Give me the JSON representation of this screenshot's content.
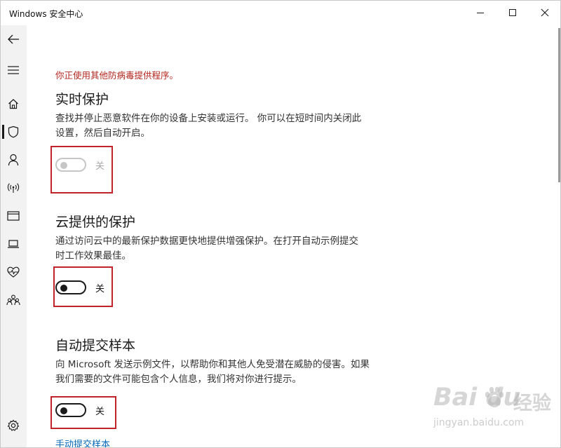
{
  "window": {
    "title": "Windows 安全中心",
    "controls": {
      "minimize_icon": "minimize-icon",
      "maximize_icon": "maximize-icon",
      "close_icon": "close-icon"
    }
  },
  "nav": {
    "items": [
      {
        "icon": "back-arrow-icon"
      },
      {
        "icon": "hamburger-menu-icon"
      },
      {
        "icon": "home-icon"
      },
      {
        "icon": "shield-icon",
        "active": true
      },
      {
        "icon": "account-icon"
      },
      {
        "icon": "network-antenna-icon"
      },
      {
        "icon": "app-browser-window-icon"
      },
      {
        "icon": "laptop-icon"
      },
      {
        "icon": "health-heart-icon"
      },
      {
        "icon": "family-icon"
      },
      {
        "icon": "gear-icon"
      }
    ]
  },
  "content": {
    "warning": "你正使用其他防病毒提供程序。",
    "sections": [
      {
        "title": "实时保护",
        "description_lines": [
          "查找并停止恶意软件在你的设备上安装或运行。 你可以在短时间内关闭此",
          "设置，然后自动开启。"
        ],
        "toggle_state": "关",
        "toggle_disabled": true
      },
      {
        "title": "云提供的保护",
        "description_lines": [
          "通过访问云中的最新保护数据更快地提供增强保护。在打开自动示例提交",
          "时工作效果最佳。"
        ],
        "toggle_state": "关",
        "toggle_disabled": false
      },
      {
        "title": "自动提交样本",
        "description_lines": [
          "向 Microsoft 发送示例文件，以帮助你和其他人免受潜在威胁的侵害。如果",
          "我们需要的文件可能包含个人信息，我们将对你进行提示。"
        ],
        "toggle_state": "关",
        "toggle_disabled": false
      }
    ],
    "manual_submit_link": "手动提交样本"
  },
  "colors": {
    "warning": "#b3261e",
    "highlight_box": "#c0242a",
    "link": "#0067b8",
    "nav_background": "#f2f2f2"
  },
  "watermark": {
    "logo": "Bai du",
    "logo_suffix": "经验",
    "url": "jingyan.baidu.com",
    "icon": "baidu-paw-icon"
  }
}
